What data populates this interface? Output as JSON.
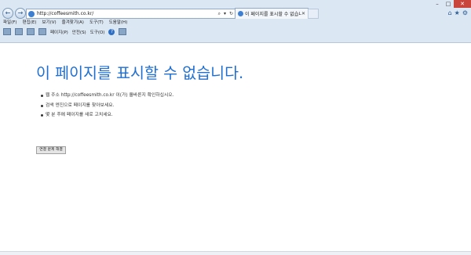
{
  "browser": {
    "address_url": "http://coffeesmith.co.kr/",
    "tab_title": "이 페이지를 표시할 수 없습니다",
    "menu": [
      "파일(F)",
      "편집(E)",
      "보기(V)",
      "즐겨찾기(A)",
      "도구(T)",
      "도움말(H)"
    ],
    "toolbar": [
      "페이지(P)",
      "안전(S)",
      "도구(O)"
    ]
  },
  "page": {
    "heading": "이 페이지를 표시할 수 없습니다.",
    "bullets": [
      "웹 주소 http://coffeesmith.co.kr 이(가) 올바른지 확인하십시오.",
      "검색 엔진으로 페이지를 찾아보세요.",
      "몇 분 후에 페이지를 새로 고치세요."
    ],
    "fix_button": "연결 문제 해결"
  }
}
